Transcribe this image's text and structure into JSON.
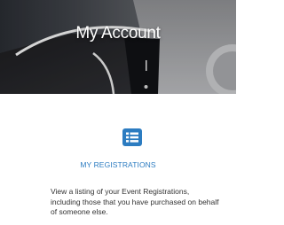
{
  "hero": {
    "title": "My Account"
  },
  "registrations": {
    "icon": "list-icon",
    "link_label": "MY REGISTRATIONS",
    "description": "View a listing of your Event Registrations, including those that you have purchased on behalf of someone else.",
    "accent_color": "#2c7cc1"
  }
}
